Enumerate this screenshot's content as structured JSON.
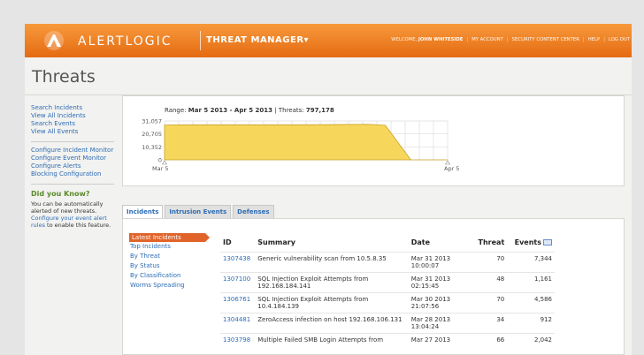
{
  "header": {
    "brand": "ALERTLOGIC",
    "product": "THREAT MANAGER▾",
    "welcome_prefix": "WELCOME, ",
    "user": "JOHN WHITESIDE",
    "links": [
      "MY ACCOUNT",
      "SECURITY CONTENT CENTER",
      "HELP",
      "LOG OUT"
    ],
    "brand_color": "#e56a12"
  },
  "page": {
    "title": "Threats"
  },
  "sidebar": {
    "group1": [
      "Search Incidents",
      "View All Incidents",
      "Search Events",
      "View All Events"
    ],
    "group2": [
      "Configure Incident Monitor",
      "Configure Event Monitor",
      "Configure Alerts",
      "Blocking Configuration"
    ],
    "dyk_title": "Did you Know?",
    "dyk_text_1": "You can be automatically alerted of new threats. ",
    "dyk_link": "Configure your event alert rules",
    "dyk_text_2": " to enable this feature."
  },
  "chart": {
    "range_label": "Range: ",
    "range_value": "Mar 5 2013 - Apr 5 2013",
    "threats_label": " | Threats: ",
    "threats_value": "797,178"
  },
  "chart_data": {
    "type": "area",
    "x": [
      "Mar 5",
      "Apr 5"
    ],
    "ytick_labels": [
      "0",
      "10,352",
      "20,705",
      "31,057"
    ],
    "ylim": [
      0,
      31057
    ],
    "series_points": [
      {
        "x": 0,
        "y": 27800
      },
      {
        "x": 0.08,
        "y": 28000
      },
      {
        "x": 0.5,
        "y": 28000
      },
      {
        "x": 0.72,
        "y": 28400
      },
      {
        "x": 0.78,
        "y": 27600
      },
      {
        "x": 0.87,
        "y": 0
      },
      {
        "x": 1.0,
        "y": 0
      }
    ],
    "fill": "#f7d65c",
    "stroke": "#c9a227"
  },
  "tabs": [
    {
      "label": "Incidents",
      "active": true
    },
    {
      "label": "Intrusion Events",
      "active": false
    },
    {
      "label": "Defenses",
      "active": false
    }
  ],
  "subnav": {
    "active": "Latest Incidents",
    "links": [
      "Top Incidents",
      "By Threat",
      "By Status",
      "By Classification",
      "Worms Spreading"
    ]
  },
  "table": {
    "headers": {
      "id": "ID",
      "summary": "Summary",
      "date": "Date",
      "threat": "Threat",
      "events": "Events"
    },
    "rows": [
      {
        "id": "1307438",
        "summary": "Generic vulnerability scan from 10.5.8.35",
        "date": "Mar 31 2013 10:00:07",
        "threat": "70",
        "events": "7,344"
      },
      {
        "id": "1307100",
        "summary": "SQL Injection Exploit Attempts from 192.168.184.141",
        "date": "Mar 31 2013 02:15:45",
        "threat": "48",
        "events": "1,161"
      },
      {
        "id": "1306761",
        "summary": "SQL Injection Exploit Attempts from 10.4.184.139",
        "date": "Mar 30 2013 21:07:56",
        "threat": "70",
        "events": "4,586"
      },
      {
        "id": "1304481",
        "summary": "ZeroAccess infection on host 192.168.106.131",
        "date": "Mar 28 2013 13:04:24",
        "threat": "34",
        "events": "912"
      },
      {
        "id": "1303798",
        "summary": "Multiple Failed SMB Login Attempts from",
        "date": "Mar 27 2013",
        "threat": "66",
        "events": "2,042"
      }
    ]
  }
}
